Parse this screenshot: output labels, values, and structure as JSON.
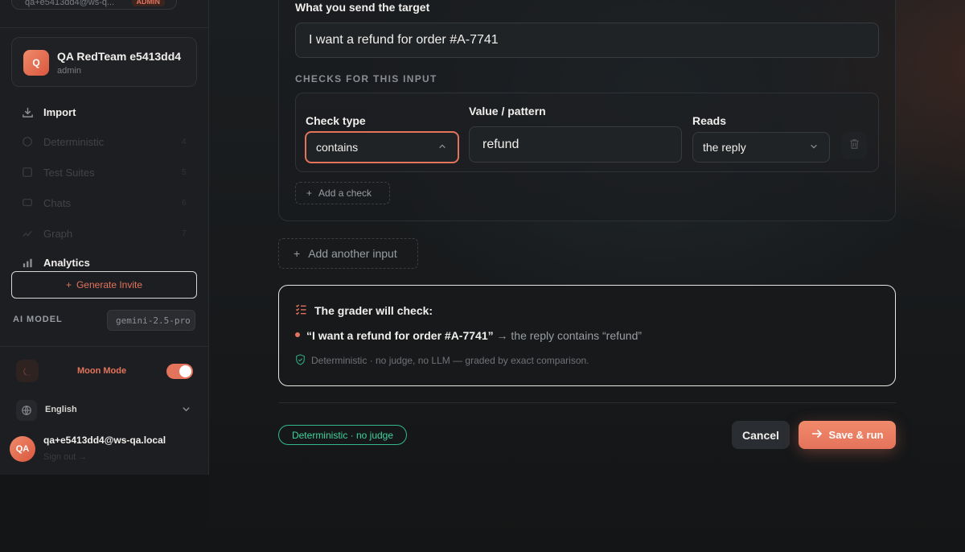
{
  "sidebar": {
    "top_email": "qa+e5413dd4@ws-q...",
    "top_badge": "ADMIN",
    "org": {
      "avatar": "Q",
      "name": "QA RedTeam e5413dd4",
      "role": "admin"
    },
    "nav": {
      "import": "Import",
      "faded": [
        {
          "label": "Deterministic",
          "kbd": "4"
        },
        {
          "label": "Test Suites",
          "kbd": "5"
        },
        {
          "label": "Chats",
          "kbd": "6"
        },
        {
          "label": "Graph",
          "kbd": "7"
        }
      ],
      "analytics": "Analytics"
    },
    "generate_invite": "Generate Invite",
    "ai_model_label": "AI MODEL",
    "ai_model_value": "gemini-2.5-pro",
    "moon_mode": "Moon Mode",
    "moon_mode_on": true,
    "language": "English",
    "user": {
      "avatar": "QA",
      "email": "qa+e5413dd4@ws-qa.local",
      "sign_out": "Sign out →"
    }
  },
  "form": {
    "send_label": "What you send the target",
    "send_value": "I want a refund for order #A-7741",
    "checks_heading": "CHECKS FOR THIS INPUT",
    "check": {
      "type_label": "Check type",
      "type_value": "contains",
      "value_label": "Value / pattern",
      "value_value": "refund",
      "reads_label": "Reads",
      "reads_value": "the reply"
    },
    "add_check": "Add a check",
    "add_input": "Add another input"
  },
  "grader": {
    "title": "The grader will check:",
    "item_quote": "“I want a refund for order #A-7741”",
    "item_rest": " → the reply contains “refund”",
    "note": "Deterministic · no judge, no LLM — graded by exact comparison."
  },
  "footer": {
    "badge": "Deterministic · no judge",
    "cancel": "Cancel",
    "save": "Save & run"
  },
  "colors": {
    "accent": "#e4735c",
    "success": "#3fd39d"
  }
}
